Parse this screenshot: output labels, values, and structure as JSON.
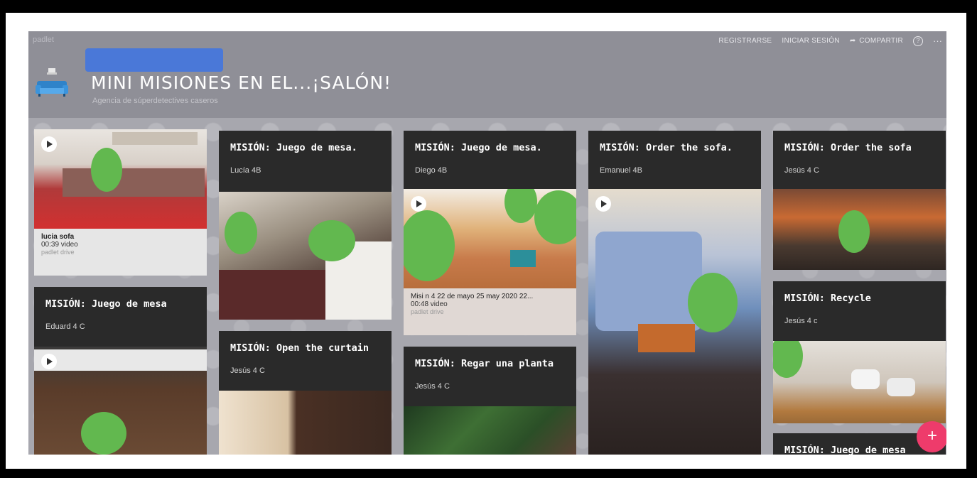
{
  "app": {
    "brand": "padlet",
    "title": "MINI MISIONES EN EL...¡SALÓN!",
    "subtitle": "Agencia de súperdetectives caseros",
    "actions": {
      "register": "REGISTRARSE",
      "login": "INICIAR SESIÓN",
      "share": "COMPARTIR",
      "help": "?",
      "more": "···"
    },
    "add_button": "+"
  },
  "columns": [
    {
      "cards": [
        {
          "caption": {
            "name": "lucia sofa",
            "meta": "00:39 video",
            "source": "padlet drive"
          }
        },
        {
          "title": "MISIÓN: Juego de mesa",
          "author": "Eduard 4 C"
        }
      ]
    },
    {
      "cards": [
        {
          "title": "MISIÓN: Juego de mesa.",
          "author": "Lucía 4B"
        },
        {
          "title": "MISIÓN: Open the curtain",
          "author": "Jesús 4 C"
        }
      ]
    },
    {
      "cards": [
        {
          "title": "MISIÓN: Juego de mesa.",
          "author": "Diego 4B",
          "caption": {
            "name": "Misi n 4 22 de mayo 25 may 2020 22...",
            "meta": "00:48 video",
            "source": "padlet drive"
          }
        },
        {
          "title": "MISIÓN: Regar una planta",
          "author": "Jesús 4 C"
        }
      ]
    },
    {
      "cards": [
        {
          "title": "MISIÓN: Order the sofa.",
          "author": "Emanuel 4B"
        }
      ]
    },
    {
      "cards": [
        {
          "title": "MISIÓN: Order the sofa",
          "author": "Jesús 4 C"
        },
        {
          "title": "MISIÓN: Recycle",
          "author": "Jesús 4 c"
        },
        {
          "title": "MISIÓN: Juego de mesa"
        }
      ]
    }
  ],
  "colors": {
    "card_bg": "#2a2a2a",
    "header_bg": "#8f8f97",
    "fab": "#ee3b6b",
    "face_blur": "#62b84f"
  }
}
